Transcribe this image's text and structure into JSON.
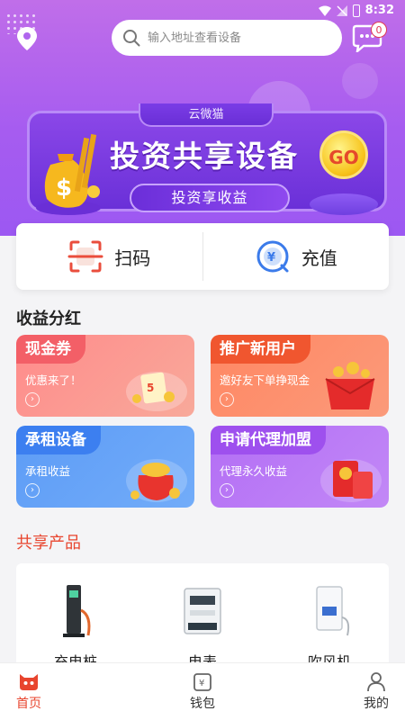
{
  "status": {
    "time": "8:32"
  },
  "header": {
    "search_placeholder": "输入地址查看设备",
    "message_count": "0"
  },
  "banner": {
    "tab": "云微猫",
    "title": "投资共享设备",
    "subtitle": "投资享收益",
    "go": "GO"
  },
  "actions": [
    {
      "label": "扫码",
      "icon": "scan-icon"
    },
    {
      "label": "充值",
      "icon": "recharge-icon"
    }
  ],
  "earnings": {
    "title": "收益分红",
    "cards": [
      {
        "tag": "现金券",
        "desc": "优惠来了！"
      },
      {
        "tag": "推广新用户",
        "desc": "邀好友下单挣现金"
      },
      {
        "tag": "承租设备",
        "desc": "承租收益"
      },
      {
        "tag": "申请代理加盟",
        "desc": "代理永久收益"
      }
    ]
  },
  "products": {
    "title": "共享产品",
    "items": [
      {
        "name": "充电桩",
        "icon": "charging-pile-icon"
      },
      {
        "name": "电表",
        "icon": "electric-meter-icon"
      },
      {
        "name": "吹风机",
        "icon": "hair-dryer-icon"
      }
    ]
  },
  "tabbar": {
    "items": [
      {
        "label": "首页",
        "icon": "home-cat-icon",
        "active": true
      },
      {
        "label": "钱包",
        "icon": "wallet-icon",
        "active": false
      },
      {
        "label": "我的",
        "icon": "profile-icon",
        "active": false
      }
    ]
  },
  "colors": {
    "accent": "#e8452e",
    "hero_top": "#c06ee9",
    "hero_bottom": "#9c58f2"
  }
}
